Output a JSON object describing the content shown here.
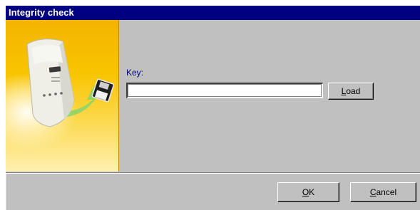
{
  "window": {
    "title": "Integrity check"
  },
  "form": {
    "key_label": "Key:",
    "key_value": "",
    "load_label_accel": "L",
    "load_label_rest": "oad"
  },
  "footer": {
    "ok_accel": "O",
    "ok_rest": "K",
    "cancel_accel": "C",
    "cancel_rest": "ancel"
  },
  "banner": {
    "icons": [
      "device-icon",
      "floppy-disk-icon"
    ],
    "colors": {
      "gold": "#f6bd00",
      "light": "#fef0b0",
      "arrow": "#7ecf6a"
    }
  },
  "colors": {
    "titlebar": "#000080",
    "dialog_bg": "#c0c0c0",
    "label": "#000080"
  }
}
